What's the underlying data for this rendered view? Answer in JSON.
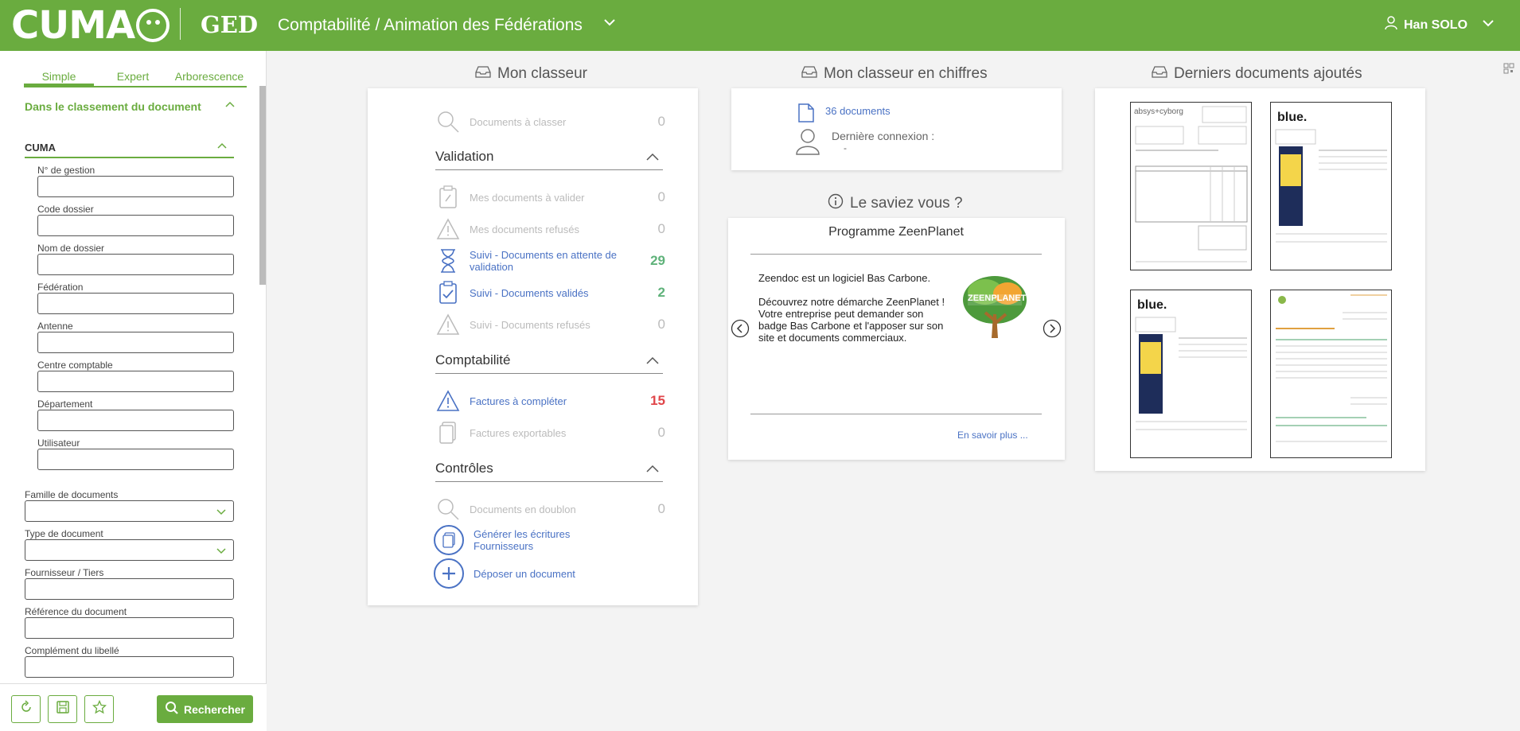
{
  "header": {
    "logo_text": "CUMA",
    "app_name": "GED",
    "context_title": "Comptabilité / Animation des Fédérations",
    "user_name": "Han SOLO"
  },
  "sidebar": {
    "tabs": [
      "Simple",
      "Expert",
      "Arborescence"
    ],
    "section_title": "Dans le classement du document",
    "cuma_title": "CUMA",
    "cuma_fields": [
      "N° de gestion",
      "Code dossier",
      "Nom de dossier",
      "Fédération",
      "Antenne",
      "Centre comptable",
      "Département",
      "Utilisateur"
    ],
    "select_fields": [
      "Famille de documents",
      "Type de document"
    ],
    "other_fields": [
      "Fournisseur / Tiers",
      "Référence du document",
      "Complément du libellé"
    ],
    "search_label": "Rechercher"
  },
  "classeur": {
    "title": "Mon classeur",
    "a_classer_label": "Documents à classer",
    "a_classer_count": "0",
    "validation_title": "Validation",
    "validation_rows": [
      {
        "label": "Mes documents à valider",
        "count": "0"
      },
      {
        "label": "Mes documents refusés",
        "count": "0"
      },
      {
        "label": "Suivi - Documents en attente de validation",
        "count": "29"
      },
      {
        "label": "Suivi - Documents validés",
        "count": "2"
      },
      {
        "label": "Suivi - Documents refusés",
        "count": "0"
      }
    ],
    "compta_title": "Comptabilité",
    "compta_rows": [
      {
        "label": "Factures à compléter",
        "count": "15"
      },
      {
        "label": "Factures exportables",
        "count": "0"
      }
    ],
    "controles_title": "Contrôles",
    "doublon_label": "Documents en doublon",
    "doublon_count": "0",
    "generer_label": "Générer les écritures Fournisseurs",
    "deposer_label": "Déposer un document"
  },
  "chiffres": {
    "title": "Mon classeur en chiffres",
    "documents": "36 documents",
    "last_login_label": "Dernière connexion :",
    "last_login_value": "-"
  },
  "saviez": {
    "title": "Le saviez vous ?",
    "program_title": "Programme ZeenPlanet",
    "text_lines": [
      "Zeendoc est un logiciel Bas Carbone.",
      "Découvrez notre démarche ZeenPlanet !",
      "Votre entreprise peut demander son badge Bas Carbone et l'apposer sur son site et documents commerciaux."
    ],
    "logo_text": "ZEENPLANET",
    "more_link": "En savoir plus ..."
  },
  "derniers": {
    "title": "Derniers documents ajoutés",
    "doc_brands": [
      "absys+cyborg",
      "blue.",
      "blue.",
      ""
    ]
  },
  "colors": {
    "brand_green": "#6aac3f",
    "link_blue": "#4a72c4",
    "count_green": "#5fb27a",
    "count_red": "#e0464a"
  }
}
